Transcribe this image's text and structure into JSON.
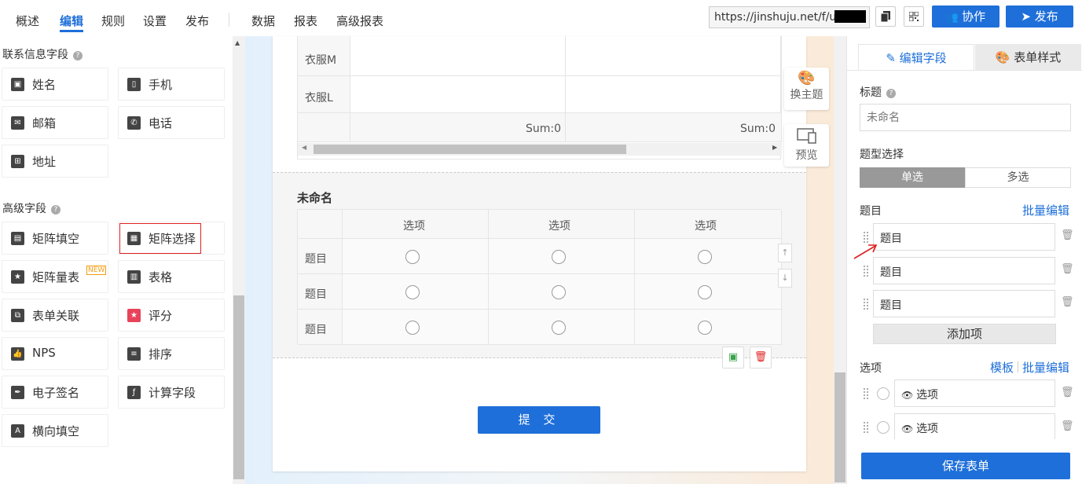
{
  "nav": {
    "items": [
      "概述",
      "编辑",
      "规则",
      "设置",
      "发布",
      "数据",
      "报表",
      "高级报表"
    ],
    "active": "编辑",
    "url": "https://jinshuju.net/f/u",
    "collaborate_label": "协作",
    "publish_label": "发布"
  },
  "left": {
    "contact_title": "联系信息字段",
    "contact_fields": [
      "姓名",
      "手机",
      "邮箱",
      "电话",
      "地址"
    ],
    "advanced_title": "高级字段",
    "advanced_fields": [
      "矩阵填空",
      "矩阵选择",
      "矩阵量表",
      "表格",
      "表单关联",
      "评分",
      "NPS",
      "排序",
      "电子签名",
      "计算字段",
      "横向填空"
    ],
    "new_badge": "NEW"
  },
  "canvas": {
    "table_rows": [
      "衣服M",
      "衣服L"
    ],
    "sum_labels": [
      "Sum:0",
      "Sum:0"
    ],
    "matrix_title": "未命名",
    "matrix_columns": [
      "选项",
      "选项",
      "选项"
    ],
    "matrix_rows": [
      "题目",
      "题目",
      "题目"
    ],
    "submit_label": "提 交",
    "theme_label": "换主题",
    "preview_label": "预览"
  },
  "right": {
    "tab_edit": "编辑字段",
    "tab_style": "表单样式",
    "title_label": "标题",
    "title_placeholder": "未命名",
    "type_label": "题型选择",
    "type_single": "单选",
    "type_multi": "多选",
    "items_label": "题目",
    "batch_edit": "批量编辑",
    "items": [
      "题目",
      "题目",
      "题目"
    ],
    "add_item": "添加项",
    "options_label": "选项",
    "template_link": "模板",
    "batch_edit2": "批量编辑",
    "options": [
      "选项",
      "选项"
    ],
    "save_label": "保存表单"
  },
  "colors": {
    "accent": "#1e6fd9",
    "highlight_border": "#e02020",
    "arrow": "#e02020"
  }
}
